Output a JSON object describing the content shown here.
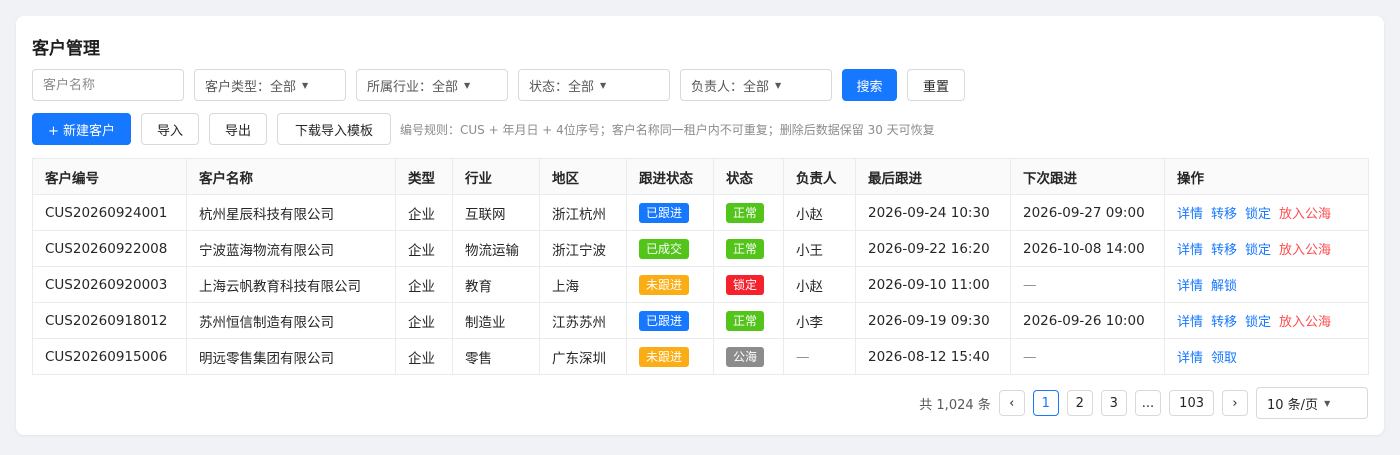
{
  "page_title": "客户管理",
  "filters": {
    "name_placeholder": "客户名称",
    "customer_type": "客户类型：全部",
    "industry": "所属行业：全部",
    "status": "状态：全部",
    "owner": "负责人：全部",
    "search_label": "搜索",
    "reset_label": "重置"
  },
  "toolbar": {
    "new_label": "+ 新建客户",
    "import_label": "导入",
    "export_label": "导出",
    "template_label": "下载导入模板",
    "hint": "编号规则：CUS + 年月日 + 4位序号；客户名称同一租户内不可重复；删除后数据保留 30 天可恢复"
  },
  "table": {
    "headers": [
      "客户编号",
      "客户名称",
      "类型",
      "行业",
      "地区",
      "跟进状态",
      "状态",
      "负责人",
      "最后跟进",
      "下次跟进",
      "操作"
    ],
    "rows": [
      {
        "id": "CUS20260924001",
        "name": "杭州星辰科技有限公司",
        "type": "企业",
        "industry": "互联网",
        "region": "浙江杭州",
        "follow": "已跟进",
        "status": "正常",
        "owner": "小赵",
        "last": "2026-09-24 10:30",
        "next": "2026-09-27 09:00",
        "ops": [
          "详情",
          "转移",
          "锁定",
          "放入公海"
        ]
      },
      {
        "id": "CUS20260922008",
        "name": "宁波蓝海物流有限公司",
        "type": "企业",
        "industry": "物流运输",
        "region": "浙江宁波",
        "follow": "已成交",
        "status": "正常",
        "owner": "小王",
        "last": "2026-09-22 16:20",
        "next": "2026-10-08 14:00",
        "ops": [
          "详情",
          "转移",
          "锁定",
          "放入公海"
        ]
      },
      {
        "id": "CUS20260920003",
        "name": "上海云帆教育科技有限公司",
        "type": "企业",
        "industry": "教育",
        "region": "上海",
        "follow": "未跟进",
        "status": "锁定",
        "owner": "小赵",
        "last": "2026-09-10 11:00",
        "next": "—",
        "ops": [
          "详情",
          "解锁"
        ]
      },
      {
        "id": "CUS20260918012",
        "name": "苏州恒信制造有限公司",
        "type": "企业",
        "industry": "制造业",
        "region": "江苏苏州",
        "follow": "已跟进",
        "status": "正常",
        "owner": "小李",
        "last": "2026-09-19 09:30",
        "next": "2026-09-26 10:00",
        "ops": [
          "详情",
          "转移",
          "锁定",
          "放入公海"
        ]
      },
      {
        "id": "CUS20260915006",
        "name": "明远零售集团有限公司",
        "type": "企业",
        "industry": "零售",
        "region": "广东深圳",
        "follow": "未跟进",
        "status": "公海",
        "owner": "—",
        "last": "2026-08-12 15:40",
        "next": "—",
        "ops": [
          "详情",
          "领取"
        ]
      }
    ]
  },
  "tag_colors": {
    "已跟进": "#1677ff",
    "已成交": "#52c41a",
    "未跟进": "#faad14",
    "正常": "#52c41a",
    "锁定": "#f5222d",
    "公海": "#8c8c8c"
  },
  "pagination": {
    "total": "共 1,024 条",
    "prev": "‹",
    "next": "›",
    "pages": [
      "1",
      "2",
      "3",
      "...",
      "103"
    ],
    "current": "1",
    "page_size": "10 条/页"
  }
}
